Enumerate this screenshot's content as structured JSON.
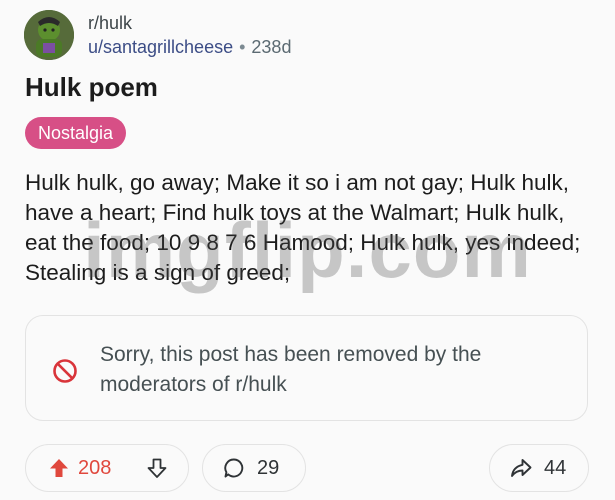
{
  "post": {
    "subreddit": "r/hulk",
    "username": "u/santagrillcheese",
    "separator": "•",
    "age": "238d",
    "title": "Hulk poem",
    "flair": "Nostalgia",
    "body": "Hulk hulk, go away; Make it so i am not gay; Hulk hulk, have a heart; Find hulk toys at the Walmart; Hulk hulk, eat the food; 10 9 8 7 6 Hamood; Hulk hulk, yes indeed; Stealing is a sign of greed;"
  },
  "watermark": "imgflip.com",
  "removed_notice": {
    "text": "Sorry, this post has been removed by the moderators of r/hulk"
  },
  "actions": {
    "upvotes": "208",
    "comments": "29",
    "shares": "44"
  },
  "colors": {
    "flair_bg": "#d74f86",
    "upvote_accent": "#e0483d",
    "ban_icon": "#d9343a"
  },
  "icons": {
    "ban": "ban-icon",
    "upvote": "arrow-up-icon",
    "downvote": "arrow-down-icon",
    "comment": "comment-bubble-icon",
    "share": "share-arrow-icon"
  }
}
